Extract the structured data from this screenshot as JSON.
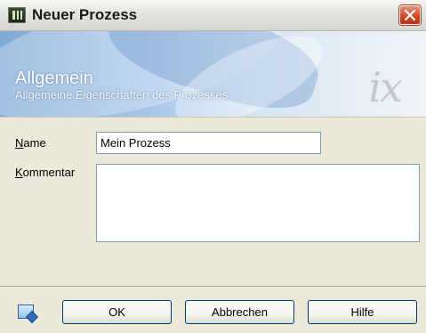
{
  "window": {
    "title": "Neuer Prozess",
    "icon": "app-icon",
    "close_icon": "close-icon"
  },
  "header": {
    "title": "Allgemein",
    "subtitle": "Allgemeine Eigenschaften des Prozesses",
    "logo_text": "ix"
  },
  "form": {
    "name_label_accel": "N",
    "name_label_rest": "ame",
    "name_value": "Mein Prozess",
    "comment_label_accel": "K",
    "comment_label_rest": "ommentar",
    "comment_value": ""
  },
  "footer": {
    "help_icon": "help-icon",
    "ok_label": "OK",
    "cancel_label": "Abbrechen",
    "help_label": "Hilfe"
  },
  "colors": {
    "close_red": "#d0441f",
    "input_border": "#7f9db9",
    "button_border": "#003c74",
    "dialog_bg": "#ece9d8"
  }
}
